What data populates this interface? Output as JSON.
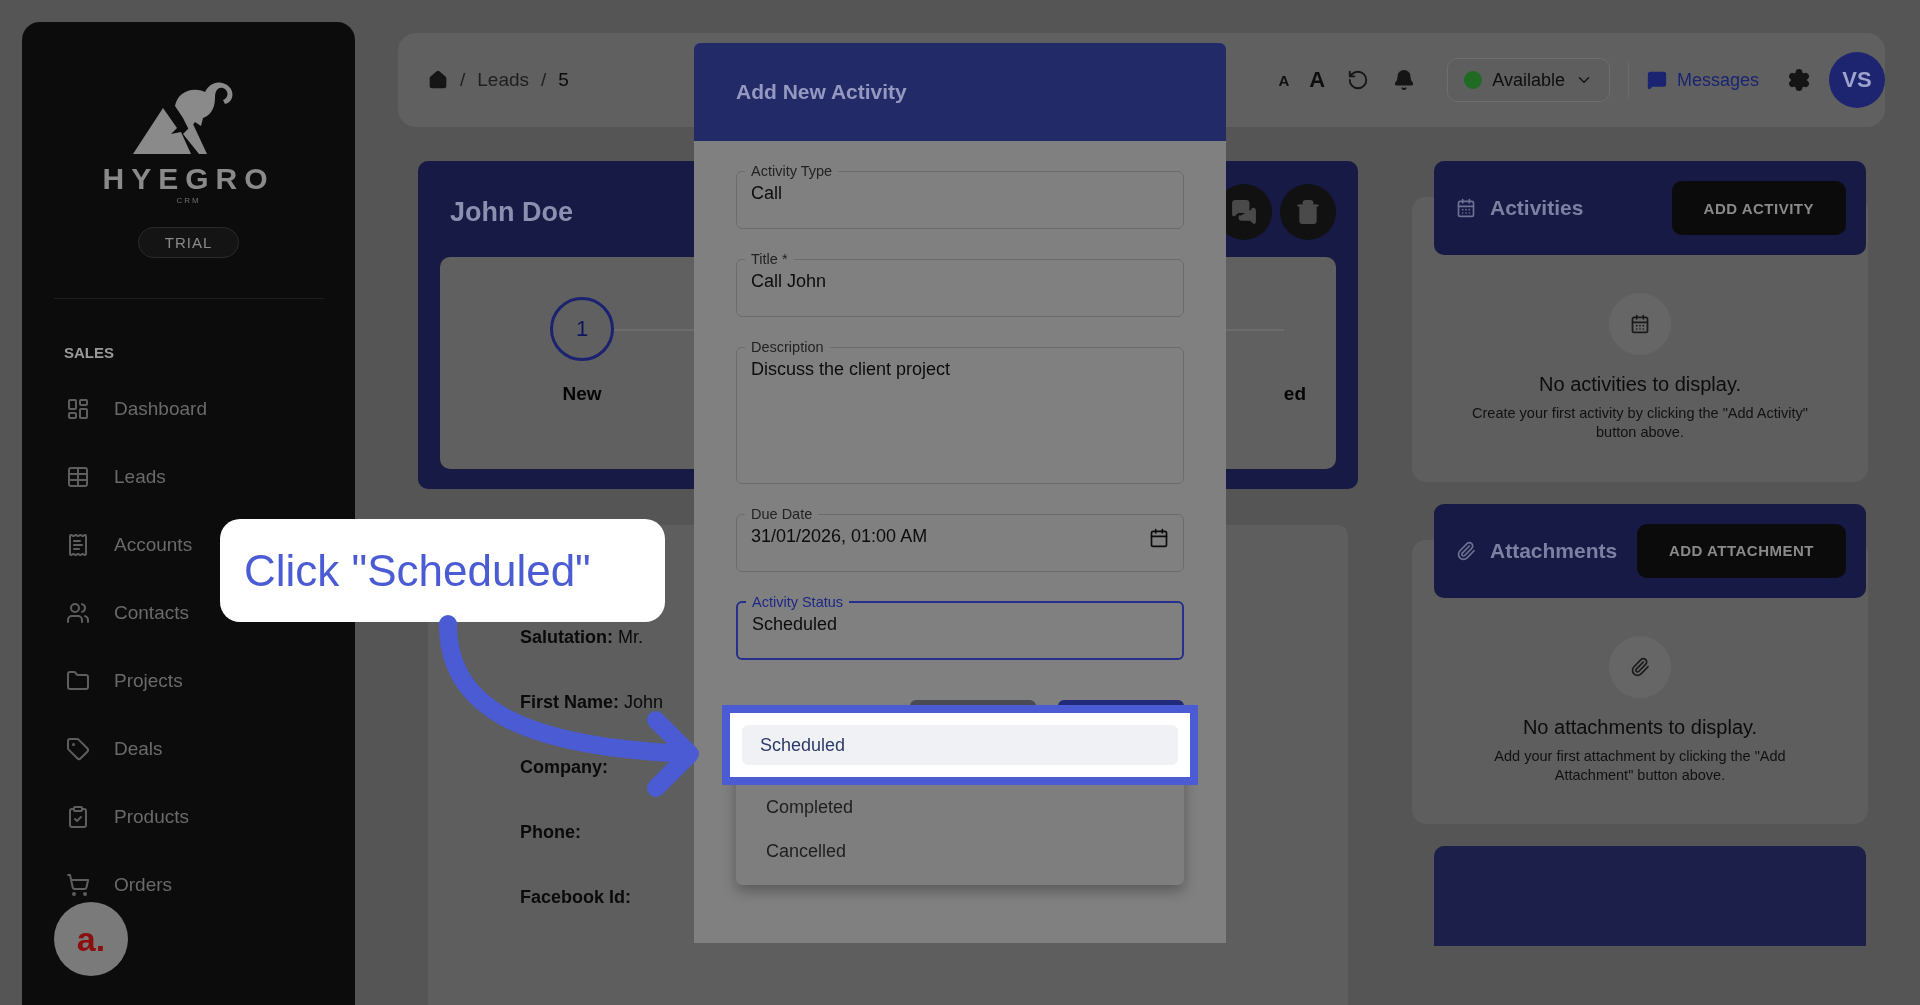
{
  "sidebar": {
    "logo_text": "HYEGRO",
    "logo_subtext": "CRM",
    "plan_badge": "TRIAL",
    "section": "SALES",
    "items": [
      {
        "label": "Dashboard"
      },
      {
        "label": "Leads"
      },
      {
        "label": "Accounts"
      },
      {
        "label": "Contacts"
      },
      {
        "label": "Projects"
      },
      {
        "label": "Deals"
      },
      {
        "label": "Products"
      },
      {
        "label": "Orders"
      }
    ]
  },
  "help_badge": {
    "text": "a."
  },
  "breadcrumb": {
    "separator": "/",
    "items": [
      "Leads",
      "5"
    ]
  },
  "toolbar": {
    "font_small": "A",
    "font_large": "A",
    "status": {
      "label": "Available",
      "color": "#1f6b24"
    },
    "messages": "Messages",
    "avatar": "VS"
  },
  "lead": {
    "name": "John Doe",
    "steps": [
      {
        "number": "1",
        "label": "New"
      },
      {
        "label": "ed"
      }
    ],
    "fields": [
      {
        "label": "Salutation:",
        "value": "Mr."
      },
      {
        "label": "First Name:",
        "value": "John"
      },
      {
        "label": "Company:"
      },
      {
        "label": "Phone:"
      },
      {
        "label": "Facebook Id:"
      }
    ]
  },
  "panels": [
    {
      "kind": "activities",
      "title": "Activities",
      "button": "ADD ACTIVITY",
      "empty_title": "No activities to display.",
      "empty_text": "Create your first activity by clicking the \"Add Activity\" button above."
    },
    {
      "kind": "attachments",
      "title": "Attachments",
      "button": "ADD ATTACHMENT",
      "empty_title": "No attachments to display.",
      "empty_text": "Add your first attachment by clicking the \"Add Attachment\" button above."
    }
  ],
  "dialog": {
    "title": "Add New Activity",
    "fields": [
      {
        "kind": "text",
        "label": "Activity Type",
        "value": "Call",
        "focused": false
      },
      {
        "kind": "text",
        "label": "Title *",
        "value": "Call John",
        "focused": false
      },
      {
        "kind": "textarea",
        "label": "Description",
        "value": "Discuss the client project",
        "focused": false
      },
      {
        "kind": "date",
        "label": "Due Date",
        "value": "31/01/2026, 01:00 AM",
        "focused": false
      },
      {
        "kind": "select",
        "label": "Activity Status",
        "value": "Scheduled",
        "focused": true
      }
    ],
    "menu": [
      {
        "label": "Scheduled",
        "selected": true
      },
      {
        "label": "Completed",
        "selected": false
      },
      {
        "label": "Cancelled",
        "selected": false
      }
    ]
  },
  "callout": {
    "text": "Click \"Scheduled\""
  }
}
